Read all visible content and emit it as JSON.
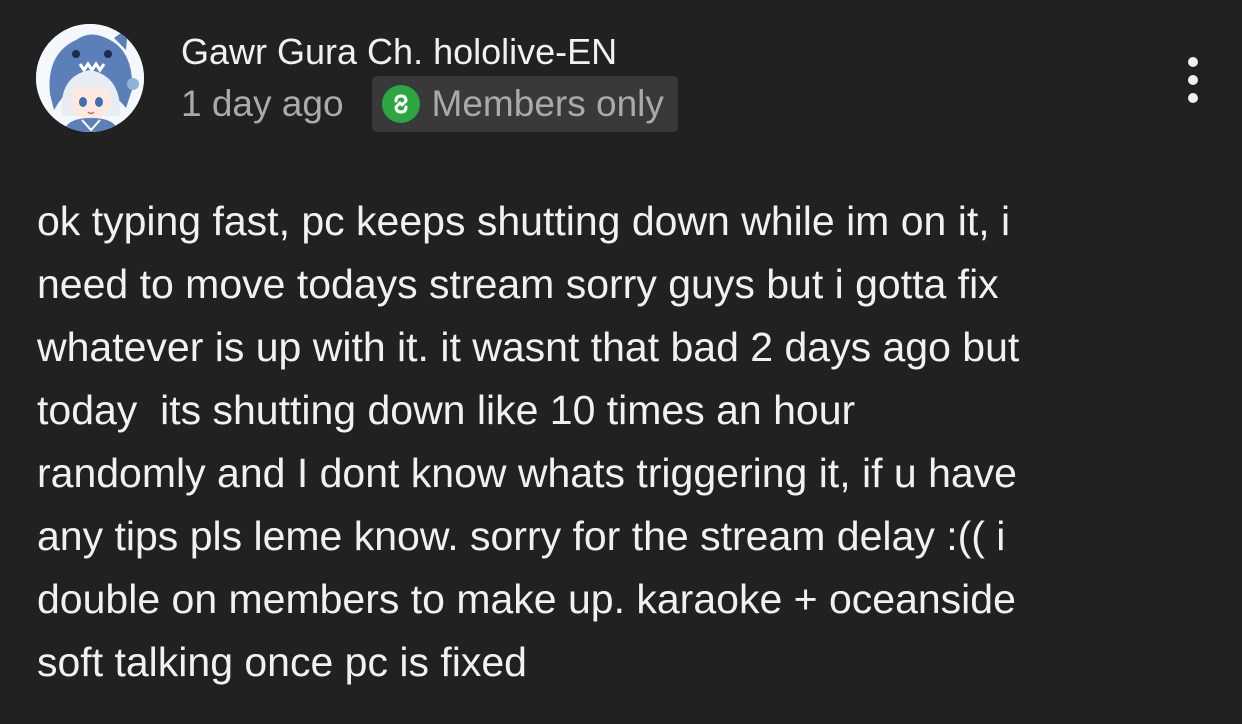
{
  "post": {
    "channel_name": "Gawr Gura Ch. hololive-EN",
    "time_ago": "1 day ago",
    "badge": {
      "label": "Members only",
      "icon": "members-badge-icon",
      "color": "#2ba640"
    },
    "avatar_icon": "channel-avatar",
    "menu_icon": "more-vertical-icon",
    "body_lines": [
      "ok typing fast, pc keeps shutting down while im on it, i",
      "need to move todays stream sorry guys but i gotta fix",
      "whatever is up with it. it wasnt that bad 2 days ago but",
      "today  its shutting down like 10 times an hour",
      "randomly and I dont know whats triggering it, if u have",
      "any tips pls leme know. sorry for the stream delay :(( i",
      "double on members to make up. karaoke + oceanside",
      "soft talking once pc is fixed"
    ]
  },
  "colors": {
    "background": "#212121",
    "primary_text": "#f1f1f1",
    "secondary_text": "#aaaaaa",
    "badge_background": "#393939"
  }
}
